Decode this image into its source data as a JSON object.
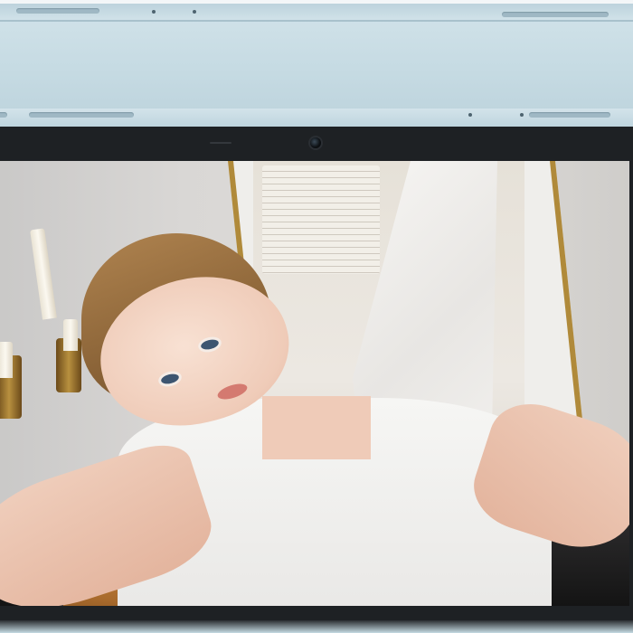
{
  "image": {
    "subject": "tablet",
    "colors": {
      "device_body": "#c6dbe3",
      "bezel": "#1e2124",
      "frame_gold": "#b08a3a",
      "cat_orange": "#c2823a",
      "shirt_white": "#f6f6f4"
    },
    "icons": [
      "camera-icon"
    ]
  }
}
